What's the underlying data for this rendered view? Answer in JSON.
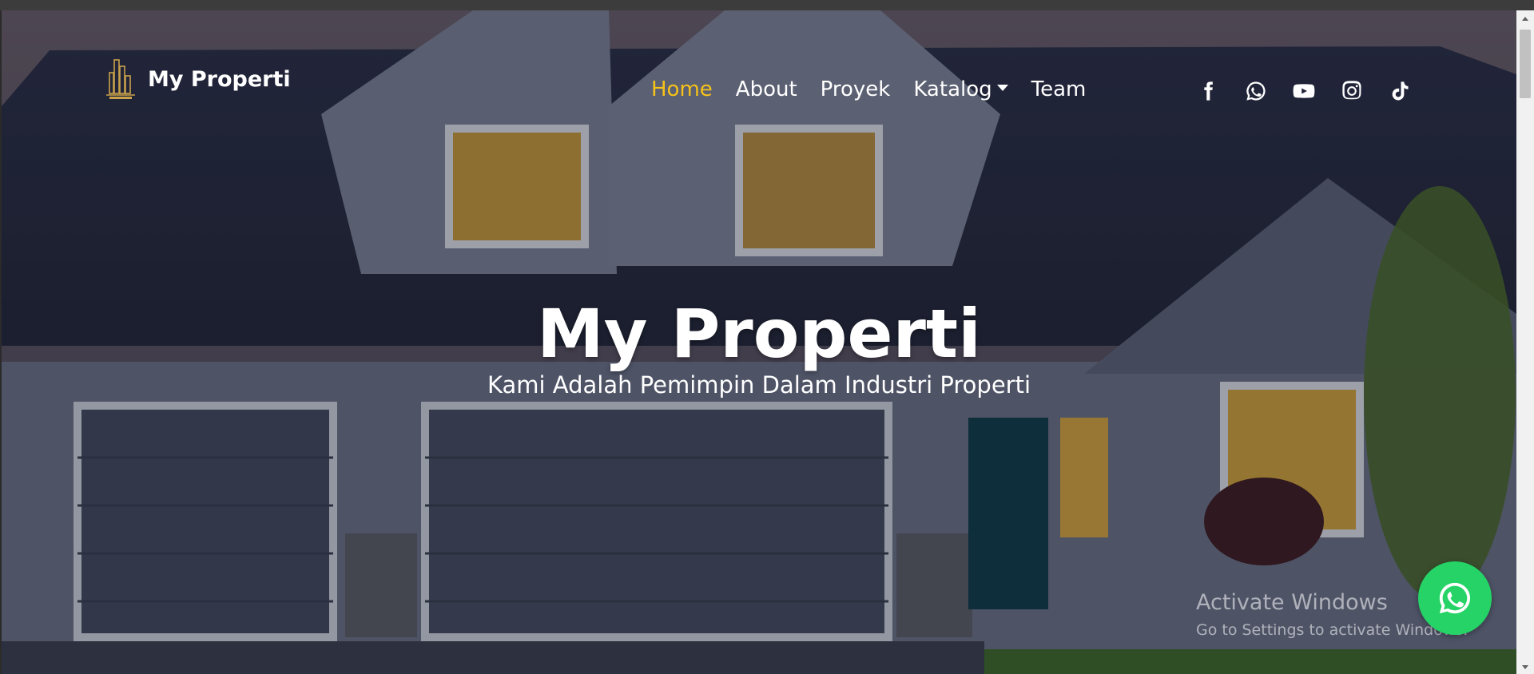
{
  "navbar": {
    "brand_name": "My Properti",
    "links": [
      {
        "label": "Home",
        "active": true
      },
      {
        "label": "About"
      },
      {
        "label": "Proyek"
      },
      {
        "label": "Katalog",
        "dropdown": true
      },
      {
        "label": "Team"
      }
    ],
    "socials": [
      "facebook-icon",
      "whatsapp-icon",
      "youtube-icon",
      "instagram-icon",
      "tiktok-icon"
    ]
  },
  "hero": {
    "title": "My Properti",
    "subtitle": "Kami Adalah Pemimpin Dalam Industri Properti"
  },
  "watermark": {
    "line1": "Activate Windows",
    "line2": "Go to Settings to activate Windows."
  },
  "floating_button": {
    "icon": "whatsapp-icon",
    "color": "#25d366"
  },
  "colors": {
    "accent": "#f6c21a",
    "nav_text": "#ffffff"
  }
}
